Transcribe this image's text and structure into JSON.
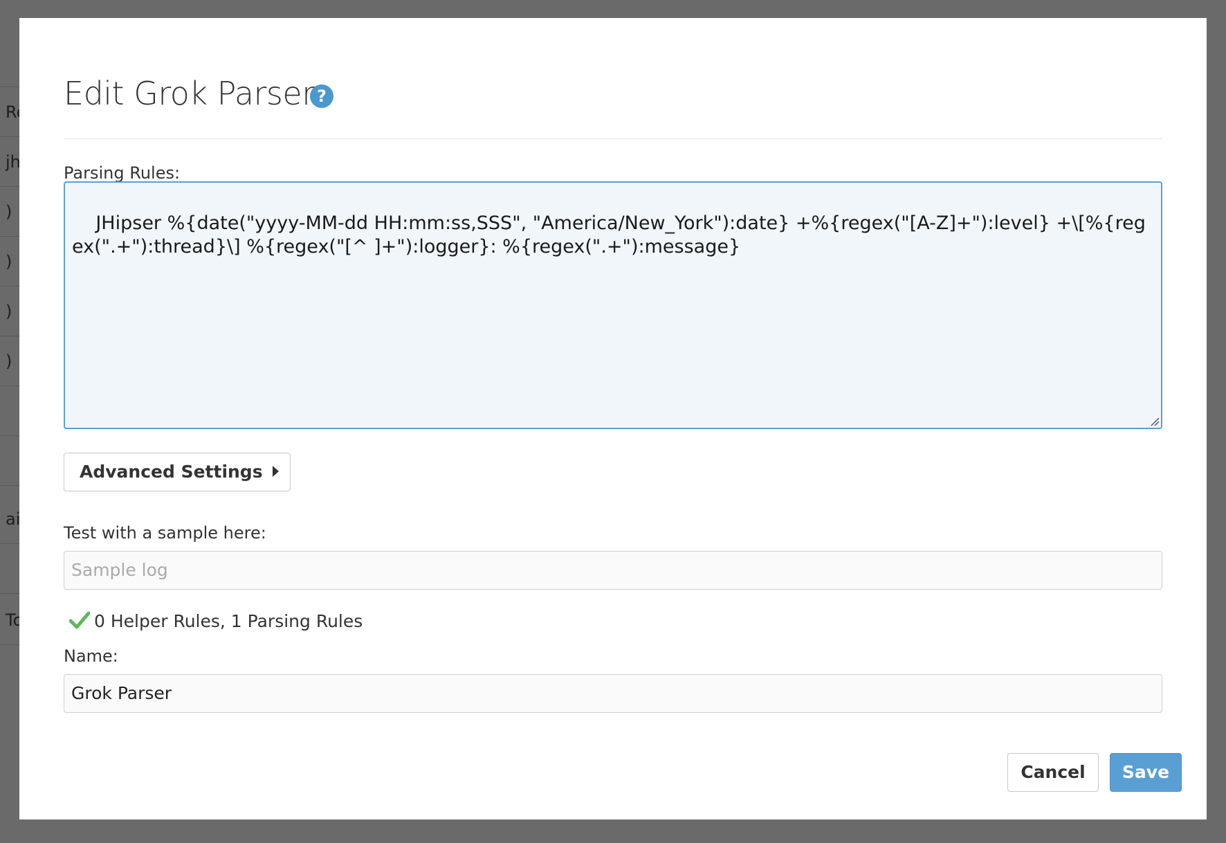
{
  "background": {
    "rows": [
      "",
      "Re",
      "jh",
      ")",
      ")",
      ")",
      ")",
      "",
      "",
      "ai",
      "",
      "To"
    ]
  },
  "modal": {
    "title": "Edit Grok Parser",
    "help_icon": "question-circle-icon",
    "parsing_rules": {
      "label": "Parsing Rules:",
      "value": "JHipser %{date(\"yyyy-MM-dd HH:mm:ss,SSS\", \"America/New_York\"):date} +%{regex(\"[A-Z]+\"):level} +\\[%{regex(\".+\"):thread}\\] %{regex(\"[^ ]+\"):logger}: %{regex(\".+\"):message}"
    },
    "advanced_settings": {
      "label": "Advanced Settings",
      "icon": "caret-right-icon"
    },
    "sample": {
      "label": "Test with a sample here:",
      "placeholder": "Sample log",
      "value": ""
    },
    "status": {
      "icon": "checkmark-icon",
      "text": "0 Helper Rules, 1 Parsing Rules",
      "color": "#5cb85c"
    },
    "name": {
      "label": "Name:",
      "value": "Grok Parser"
    },
    "buttons": {
      "cancel": "Cancel",
      "save": "Save"
    }
  },
  "colors": {
    "accent": "#5a9fd4",
    "overlay": "#6a6a6a"
  }
}
